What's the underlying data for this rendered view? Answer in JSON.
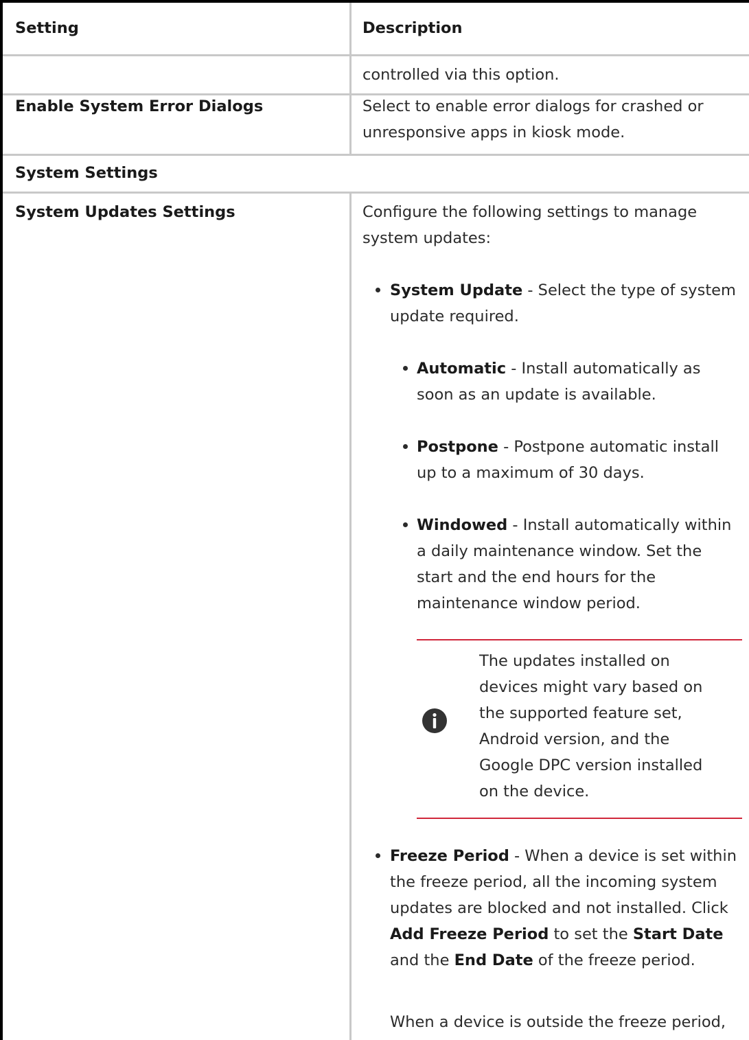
{
  "table": {
    "header": {
      "setting": "Setting",
      "description": "Description"
    },
    "row_continued": {
      "description": "controlled via this option."
    },
    "row_error_dialogs": {
      "setting": "Enable System Error Dialogs",
      "description_line1": "Select to enable error dialogs for crashed or",
      "description_line2": "unresponsive apps in kiosk mode."
    },
    "section_system_settings": "System Settings",
    "row_system_updates": {
      "setting": "System Updates Settings",
      "intro_line1": "Configure the following settings to manage",
      "intro_line2": "system updates:",
      "system_update": {
        "term": "System Update",
        "line1_rest": " - Select the type of system",
        "line2": "update required."
      },
      "automatic": {
        "term": "Automatic",
        "line1_rest": " - Install automatically as",
        "line2": "soon as an update is available."
      },
      "postpone": {
        "term": "Postpone",
        "line1_rest": " - Postpone automatic install",
        "line2": "up to a maximum of 30 days."
      },
      "windowed": {
        "term": "Windowed",
        "line1_rest": " - Install automatically within",
        "line2": "a daily maintenance window. Set the",
        "line3": "start and the end hours for the",
        "line4": "maintenance window period."
      },
      "note": {
        "icon": "info-icon",
        "line1": "The updates installed on",
        "line2": "devices might vary based on",
        "line3": "the supported feature set,",
        "line4": "Android version, and the",
        "line5": "Google DPC version installed",
        "line6": "on the device."
      },
      "freeze_period": {
        "term": "Freeze Period",
        "line1_rest": " - When a device is set within",
        "line2": "the freeze period, all the incoming system",
        "line3": "updates are blocked and not installed. Click",
        "add_freeze": "Add Freeze Period",
        "to_set": " to set the ",
        "start_date": "Start Date",
        "and_the": "and the ",
        "end_date": "End Date",
        "of_period": " of the freeze period."
      },
      "outside_freeze": "When a device is outside the freeze period,"
    }
  },
  "colors": {
    "note_rule": "#d0263a",
    "border": "#c8c8c8",
    "frame": "#000000"
  }
}
